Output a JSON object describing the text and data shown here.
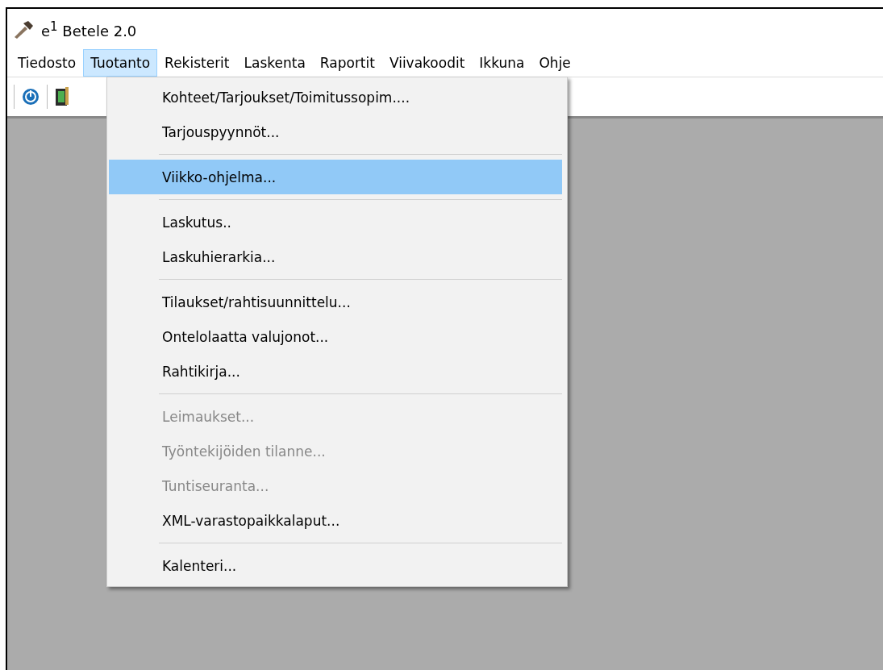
{
  "window": {
    "title": "e$^{1}$ Betele 2.0"
  },
  "menubar": [
    {
      "label": "Tiedosto",
      "selected": false
    },
    {
      "label": "Tuotanto",
      "selected": true
    },
    {
      "label": "Rekisterit",
      "selected": false
    },
    {
      "label": "Laskenta",
      "selected": false
    },
    {
      "label": "Raportit",
      "selected": false
    },
    {
      "label": "Viivakoodit",
      "selected": false
    },
    {
      "label": "Ikkuna",
      "selected": false
    },
    {
      "label": "Ohje",
      "selected": false
    }
  ],
  "menu": [
    {
      "kind": "item",
      "label": "Kohteet/Tarjoukset/Toimitussopim....",
      "selected": false,
      "disabled": false
    },
    {
      "kind": "item",
      "label": "Tarjouspyynnöt...",
      "selected": false,
      "disabled": false
    },
    {
      "kind": "separator"
    },
    {
      "kind": "item",
      "label": "Viikko-ohjelma...",
      "selected": true,
      "disabled": false
    },
    {
      "kind": "separator"
    },
    {
      "kind": "item",
      "label": "Laskutus..",
      "selected": false,
      "disabled": false
    },
    {
      "kind": "item",
      "label": "Laskuhierarkia...",
      "selected": false,
      "disabled": false
    },
    {
      "kind": "separator"
    },
    {
      "kind": "item",
      "label": "Tilaukset/rahtisuunnittelu...",
      "selected": false,
      "disabled": false
    },
    {
      "kind": "item",
      "label": "Ontelolaatta valujonot...",
      "selected": false,
      "disabled": false
    },
    {
      "kind": "item",
      "label": "Rahtikirja...",
      "selected": false,
      "disabled": false
    },
    {
      "kind": "separator"
    },
    {
      "kind": "item",
      "label": "Leimaukset...",
      "selected": false,
      "disabled": true
    },
    {
      "kind": "item",
      "label": "Työntekijöiden tilanne...",
      "selected": false,
      "disabled": true
    },
    {
      "kind": "item",
      "label": "Tuntiseuranta...",
      "selected": false,
      "disabled": true
    },
    {
      "kind": "item",
      "label": "XML-varastopaikkalaput...",
      "selected": false,
      "disabled": false
    },
    {
      "kind": "separator"
    },
    {
      "kind": "item",
      "label": "Kalenteri...",
      "selected": false,
      "disabled": false
    }
  ]
}
